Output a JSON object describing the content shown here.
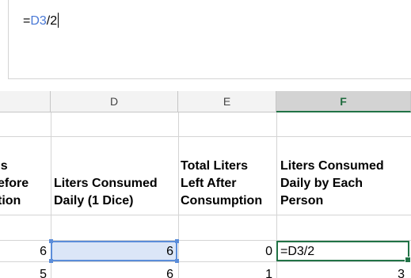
{
  "formula_bar": {
    "prefix": "=",
    "ref": "D3",
    "suffix": "/2"
  },
  "columns": {
    "d": "D",
    "e": "E",
    "f": "F"
  },
  "header_row": {
    "c_line1": "'s",
    "c_line2": "efore",
    "c_line3": "tion",
    "d_line2": "Liters Consumed",
    "d_line3": "Daily (1 Dice)",
    "e_line1": "Total Liters",
    "e_line2": "Left After",
    "e_line3": "Consumption",
    "f_line1": "Liters Consumed",
    "f_line2": "Daily by Each",
    "f_line3": "Person"
  },
  "row3": {
    "c": "6",
    "d": "6",
    "e": "0",
    "f": "=D3/2"
  },
  "row4": {
    "c": "5",
    "d": "6",
    "e": "1",
    "f": "3"
  },
  "colors": {
    "active_header": "#217346",
    "selection_blue": "#5b8dd9",
    "formula_ref": "#4a79d6"
  }
}
